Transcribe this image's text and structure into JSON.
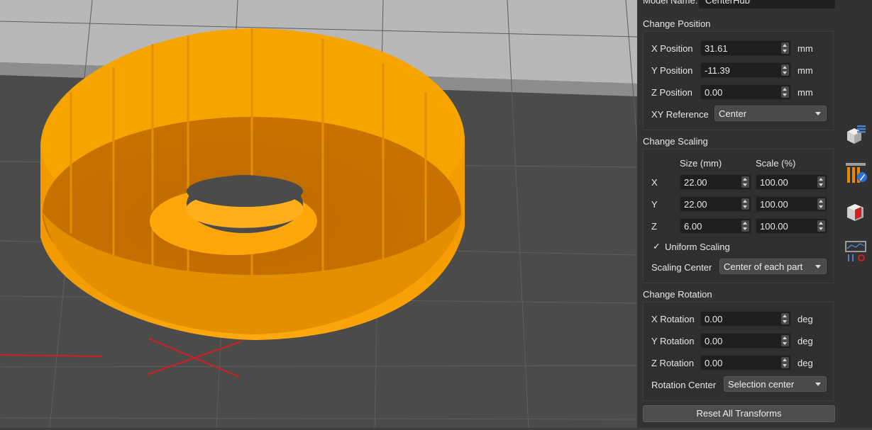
{
  "model": {
    "label": "Model Name:",
    "value": "CenterHub"
  },
  "position": {
    "title": "Change Position",
    "x_label": "X Position",
    "x_value": "31.61",
    "y_label": "Y Position",
    "y_value": "-11.39",
    "z_label": "Z Position",
    "z_value": "0.00",
    "unit": "mm",
    "xy_ref_label": "XY Reference",
    "xy_ref_value": "Center"
  },
  "scaling": {
    "title": "Change Scaling",
    "size_header": "Size (mm)",
    "scale_header": "Scale (%)",
    "rows": [
      {
        "axis": "X",
        "size": "22.00",
        "scale": "100.00"
      },
      {
        "axis": "Y",
        "size": "22.00",
        "scale": "100.00"
      },
      {
        "axis": "Z",
        "size": "6.00",
        "scale": "100.00"
      }
    ],
    "uniform_check": "✓",
    "uniform_label": "Uniform Scaling",
    "center_label": "Scaling Center",
    "center_value": "Center of each part"
  },
  "rotation": {
    "title": "Change Rotation",
    "x_label": "X Rotation",
    "x_value": "0.00",
    "y_label": "Y Rotation",
    "y_value": "0.00",
    "z_label": "Z Rotation",
    "z_value": "0.00",
    "unit": "deg",
    "center_label": "Rotation Center",
    "center_value": "Selection center"
  },
  "reset_button": "Reset All Transforms",
  "tools": [
    "object-list-icon",
    "supports-paint-icon",
    "modifier-mesh-icon",
    "placement-settings-icon"
  ],
  "colors": {
    "part": "#f7a300",
    "bed": "#4a4a4a",
    "panel": "#323232",
    "axis_x": "#d12020"
  }
}
